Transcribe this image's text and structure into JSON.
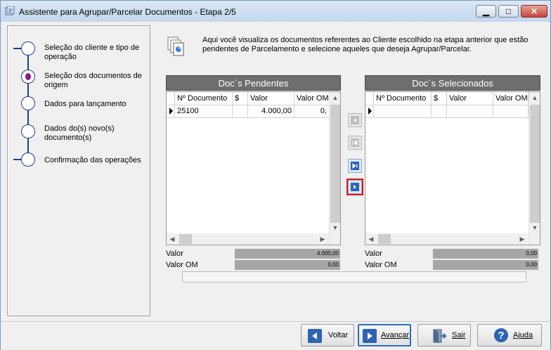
{
  "window": {
    "title": "Assistente para Agrupar/Parcelar Documentos - Etapa 2/5",
    "icons": {
      "app": "wizard-app-icon",
      "minimize": "minimize-icon",
      "maximize": "maximize-icon",
      "close": "close-icon"
    }
  },
  "steps": [
    {
      "label": "Seleção do cliente e tipo de operação",
      "state": "done"
    },
    {
      "label": "Seleção dos documentos de origem",
      "state": "current"
    },
    {
      "label": "Dados para lançamento",
      "state": "pending"
    },
    {
      "label": "Dados do(s) novo(s) documento(s)",
      "state": "pending"
    },
    {
      "label": "Confirmação das operações",
      "state": "pending"
    }
  ],
  "info": {
    "icon": "documents-icon",
    "text": "Aqui você visualiza os documentos referentes ao Cliente escolhido na etapa anterior que estão pendentes de Parcelamento e selecione aqueles que deseja Agrupar/Parcelar."
  },
  "pending": {
    "title": "Doc´s Pendentes",
    "columns": [
      "Nº Documento",
      "$",
      "Valor",
      "Valor OM"
    ],
    "rows": [
      {
        "doc": "25100",
        "currency": "",
        "valor": "4.000,00",
        "valor_om": "0,"
      }
    ],
    "totals": {
      "valor_label": "Valor",
      "valor": "4.000,00",
      "om_label": "Valor OM",
      "om": "0,00"
    }
  },
  "selected": {
    "title": "Doc´s Selecionados",
    "columns": [
      "Nº Documento",
      "$",
      "Valor",
      "Valor OM"
    ],
    "rows": [],
    "totals": {
      "valor_label": "Valor",
      "valor": "0,00",
      "om_label": "Valor OM",
      "om": "0,00"
    }
  },
  "transfer_buttons": [
    {
      "name": "move-left-icon",
      "enabled": false
    },
    {
      "name": "move-all-left-icon",
      "enabled": false
    },
    {
      "name": "move-all-right-icon",
      "enabled": true
    },
    {
      "name": "move-right-icon",
      "enabled": true,
      "highlighted": true
    }
  ],
  "buttons": {
    "voltar": "Voltar",
    "avancar": "Avançar",
    "sair": "Sair",
    "ajuda": "Ajuda"
  },
  "colors": {
    "step_line": "#1f3e8f",
    "current_step_dot": "#8a1a8a",
    "panel_header": "#6e6e6e",
    "highlight_border": "#e01818",
    "button_icon": "#2b63b5"
  }
}
